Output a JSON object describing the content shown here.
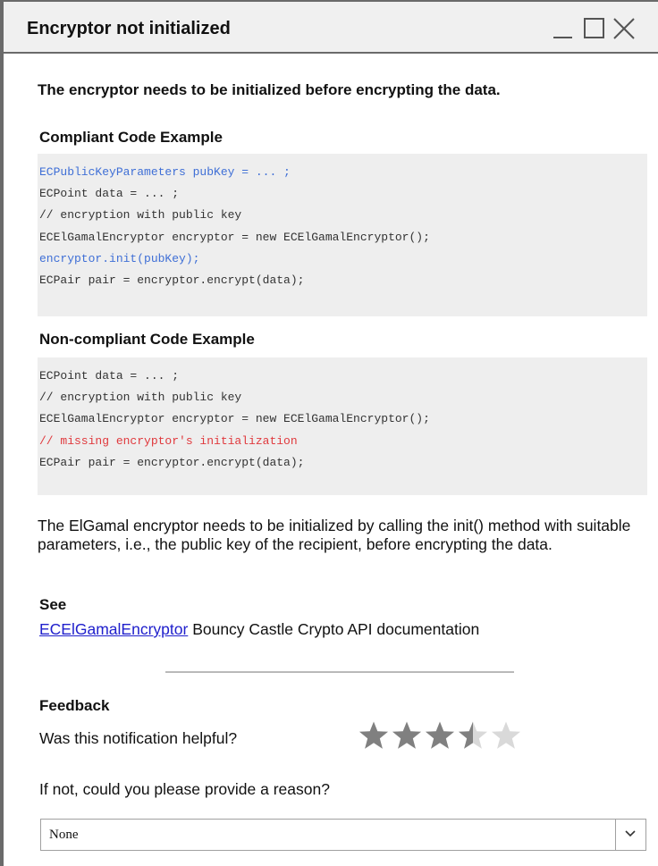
{
  "window": {
    "title": "Encryptor not initialized",
    "buttons": [
      "minimize",
      "maximize",
      "close"
    ]
  },
  "lead": "The encryptor needs to be initialized before encrypting the data.",
  "compliant": {
    "heading": "Compliant Code Example",
    "lines": [
      {
        "text": "ECPublicKeyParameters pubKey = ... ;",
        "color": "#3f6fd6"
      },
      {
        "text": "ECPoint data = ... ;",
        "color": "#333333"
      },
      {
        "text": "// encryption with public key",
        "color": "#333333"
      },
      {
        "text": "ECElGamalEncryptor encryptor = new ECElGamalEncryptor();",
        "color": "#333333"
      },
      {
        "text": "encryptor.init(pubKey);",
        "color": "#3f6fd6"
      },
      {
        "text": "ECPair pair = encryptor.encrypt(data);",
        "color": "#333333"
      }
    ]
  },
  "noncompliant": {
    "heading": "Non-compliant Code Example",
    "lines": [
      {
        "text": "ECPoint data = ... ;",
        "color": "#333333"
      },
      {
        "text": "// encryption with public key",
        "color": "#333333"
      },
      {
        "text": "ECElGamalEncryptor encryptor = new ECElGamalEncryptor();",
        "color": "#333333"
      },
      {
        "text": "// missing encryptor's initialization",
        "color": "#e0393d"
      },
      {
        "text": "ECPair pair = encryptor.encrypt(data);",
        "color": "#333333"
      }
    ]
  },
  "description": "The ElGamal encryptor needs to be initialized by calling the init() method with suitable parameters, i.e., the public key of the recipient, before encrypting the data.",
  "see": {
    "heading": "See",
    "link": "ECElGamalEncryptor",
    "text": "Bouncy Castle Crypto API documentation"
  },
  "feedback": {
    "heading": "Feedback",
    "question": "Was this notification helpful?",
    "rating": 3.5,
    "rating_max": 5,
    "star_color": "#808080",
    "star_empty_color": "#d9d9d9",
    "reason_prompt": "If not, could you please provide a reason?",
    "reason_selected": "None"
  }
}
